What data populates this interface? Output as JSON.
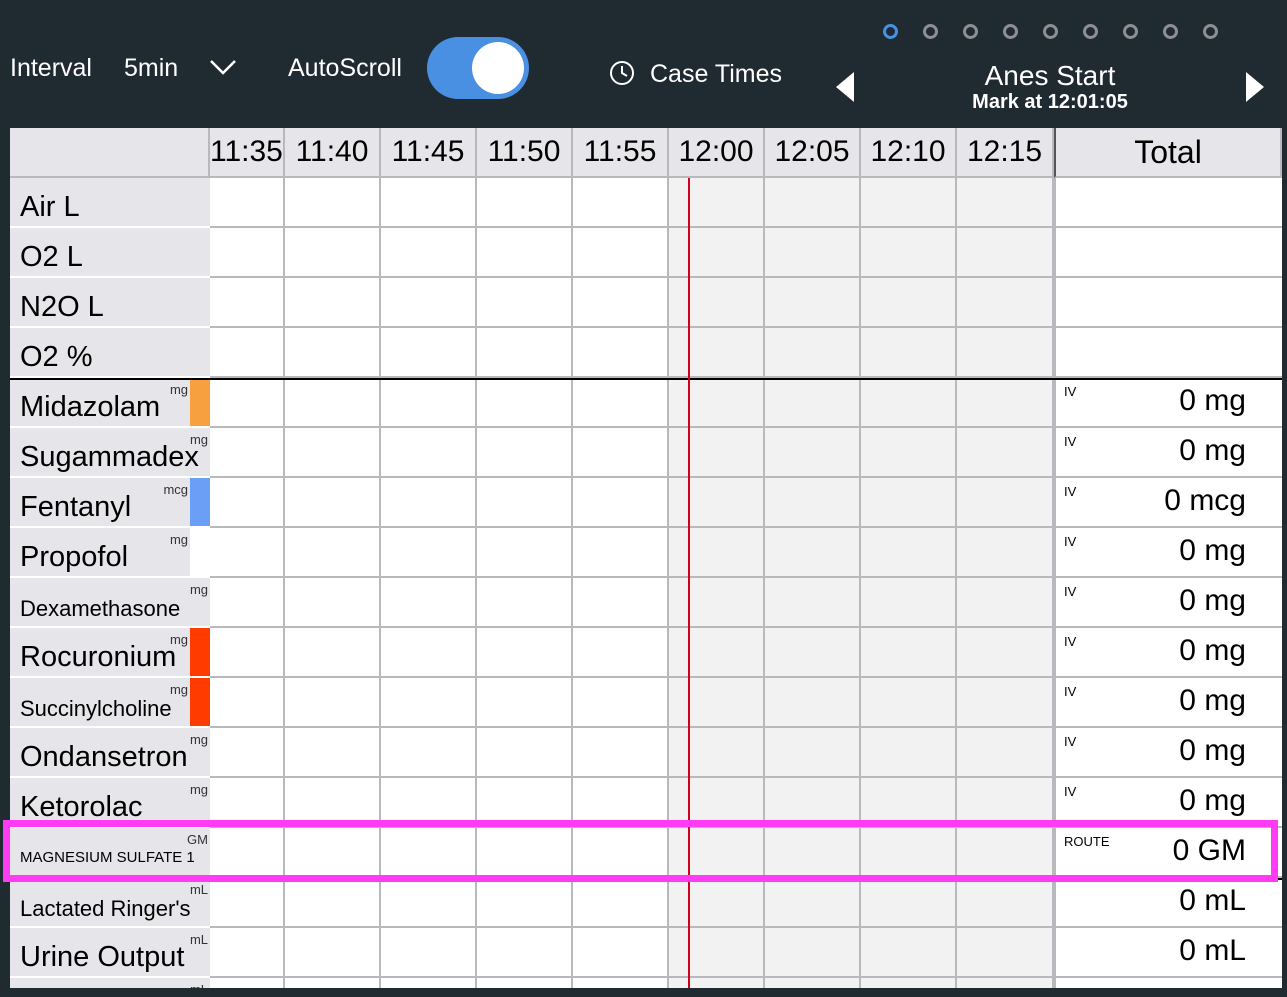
{
  "toolbar": {
    "interval_label": "Interval",
    "interval_value": "5min",
    "autoscroll_label": "AutoScroll",
    "autoscroll_on": true,
    "case_times_label": "Case Times",
    "page_dots": 9,
    "active_dot": 0,
    "event_title": "Anes Start",
    "event_subtitle": "Mark at 12:01:05"
  },
  "grid": {
    "time_columns": [
      "11:35",
      "11:40",
      "11:45",
      "11:50",
      "11:55",
      "12:00",
      "12:05",
      "12:10",
      "12:15"
    ],
    "total_header": "Total",
    "rows": [
      {
        "name": "Air L",
        "unit": "",
        "route": "",
        "total": "",
        "size": "normal",
        "color": ""
      },
      {
        "name": "O2 L",
        "unit": "",
        "route": "",
        "total": "",
        "size": "normal",
        "color": ""
      },
      {
        "name": "N2O L",
        "unit": "",
        "route": "",
        "total": "",
        "size": "normal",
        "color": ""
      },
      {
        "name": "O2 %",
        "unit": "",
        "route": "",
        "total": "",
        "size": "normal",
        "color": ""
      },
      {
        "name": "Midazolam",
        "unit": "mg",
        "route": "IV",
        "total": "0 mg",
        "size": "normal",
        "color": "#f7a040"
      },
      {
        "name": "Sugammadex",
        "unit": "mg",
        "route": "IV",
        "total": "0 mg",
        "size": "normal",
        "color": ""
      },
      {
        "name": "Fentanyl",
        "unit": "mcg",
        "route": "IV",
        "total": "0 mcg",
        "size": "normal",
        "color": "#6b9ff5"
      },
      {
        "name": "Propofol",
        "unit": "mg",
        "route": "IV",
        "total": "0 mg",
        "size": "normal",
        "color": "#ffffff"
      },
      {
        "name": "Dexamethasone",
        "unit": "mg",
        "route": "IV",
        "total": "0 mg",
        "size": "small",
        "color": ""
      },
      {
        "name": "Rocuronium",
        "unit": "mg",
        "route": "IV",
        "total": "0 mg",
        "size": "normal",
        "color": "#ff3b00"
      },
      {
        "name": "Succinylcholine",
        "unit": "mg",
        "route": "IV",
        "total": "0 mg",
        "size": "small",
        "color": "#ff3b00"
      },
      {
        "name": "Ondansetron",
        "unit": "mg",
        "route": "IV",
        "total": "0 mg",
        "size": "normal",
        "color": ""
      },
      {
        "name": "Ketorolac",
        "unit": "mg",
        "route": "IV",
        "total": "0 mg",
        "size": "normal",
        "color": ""
      },
      {
        "name": "MAGNESIUM SULFATE 1",
        "unit": "GM",
        "route": "ROUTE",
        "total": "0 GM",
        "size": "tiny",
        "color": ""
      },
      {
        "name": "Lactated Ringer's",
        "unit": "mL",
        "route": "",
        "total": "0 mL",
        "size": "small",
        "color": ""
      },
      {
        "name": "Urine Output",
        "unit": "mL",
        "route": "",
        "total": "0 mL",
        "size": "normal",
        "color": ""
      },
      {
        "name": "",
        "unit": "mL",
        "route": "",
        "total": "",
        "size": "normal",
        "color": ""
      }
    ]
  }
}
